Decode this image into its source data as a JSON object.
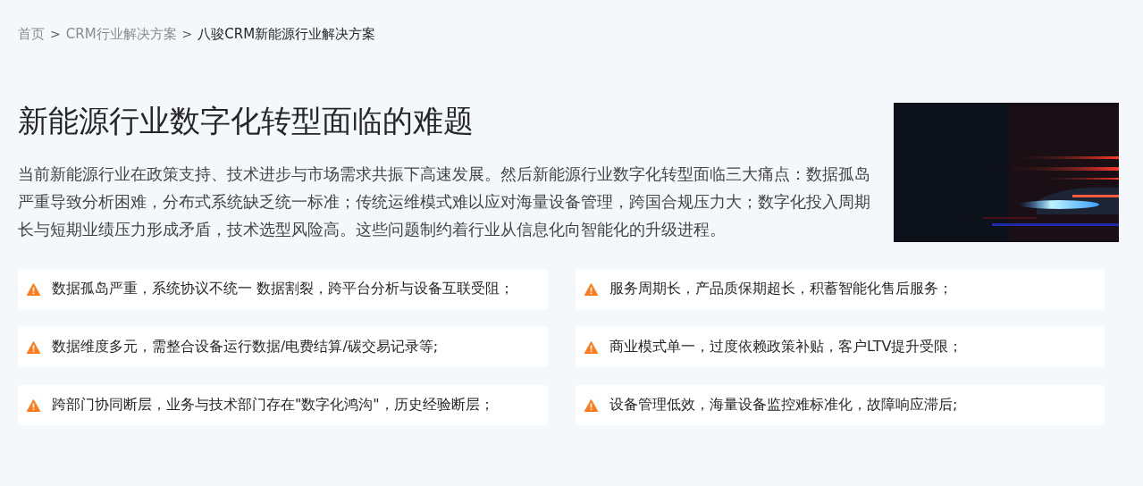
{
  "breadcrumb": [
    {
      "kind": "link",
      "text": "首页"
    },
    {
      "kind": "separator",
      "text": ">"
    },
    {
      "kind": "link",
      "text": "CRM行业解决方案"
    },
    {
      "kind": "separator",
      "text": ">"
    },
    {
      "kind": "current",
      "text": "八骏CRM新能源行业解决方案"
    }
  ],
  "section": {
    "title": "新能源行业数字化转型面临的难题",
    "description": "当前新能源行业在政策支持、技术进步与市场需求共振下高速发展。然后新能源行业数字化转型面临三大痛点：数据孤岛严重导致分析困难，分布式系统缺乏统一标准；传统运维模式难以应对海量设备管理，跨国合规压力大；数字化投入周期长与短期业绩压力形成矛盾，技术选型风险高。这些问题制约着行业从信息化向智能化的升级进程。"
  },
  "pain_points": [
    {
      "text": "数据孤岛严重，系统协议不统一 数据割裂，跨平台分析与设备互联受阻；"
    },
    {
      "text": "服务周期长，产品质保期超长，积蓄智能化售后服务；"
    },
    {
      "text": "数据维度多元，需整合设备运行数据/电费结算/碳交易记录等;"
    },
    {
      "text": "商业模式单一，过度依赖政策补贴，客户LTV提升受限；"
    },
    {
      "text": "跨部门协同断层，业务与技术部门存在\"数字化鸿沟\"，历史经验断层；"
    },
    {
      "text": "设备管理低效，海量设备监控难标准化，故障响应滞后;"
    }
  ]
}
